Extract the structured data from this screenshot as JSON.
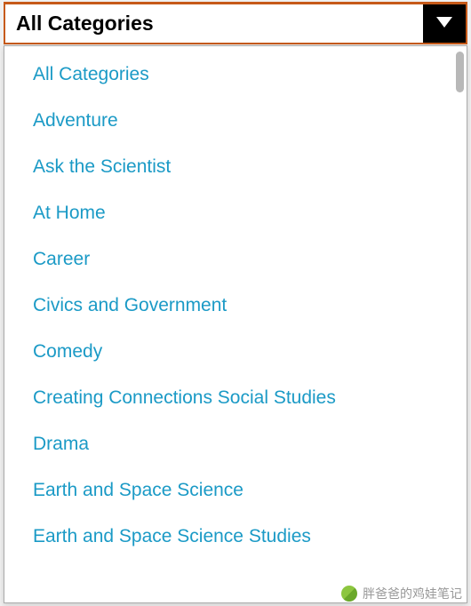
{
  "dropdown": {
    "selected": "All Categories",
    "items": [
      "All Categories",
      "Adventure",
      "Ask the Scientist",
      "At Home",
      "Career",
      "Civics and Government",
      "Comedy",
      "Creating Connections Social Studies",
      "Drama",
      "Earth and Space Science",
      "Earth and Space Science Studies"
    ]
  },
  "watermark": {
    "text": "胖爸爸的鸡娃笔记"
  },
  "colors": {
    "accent_border": "#c65a19",
    "link": "#1b9ac6",
    "toggle_bg": "#000000"
  }
}
